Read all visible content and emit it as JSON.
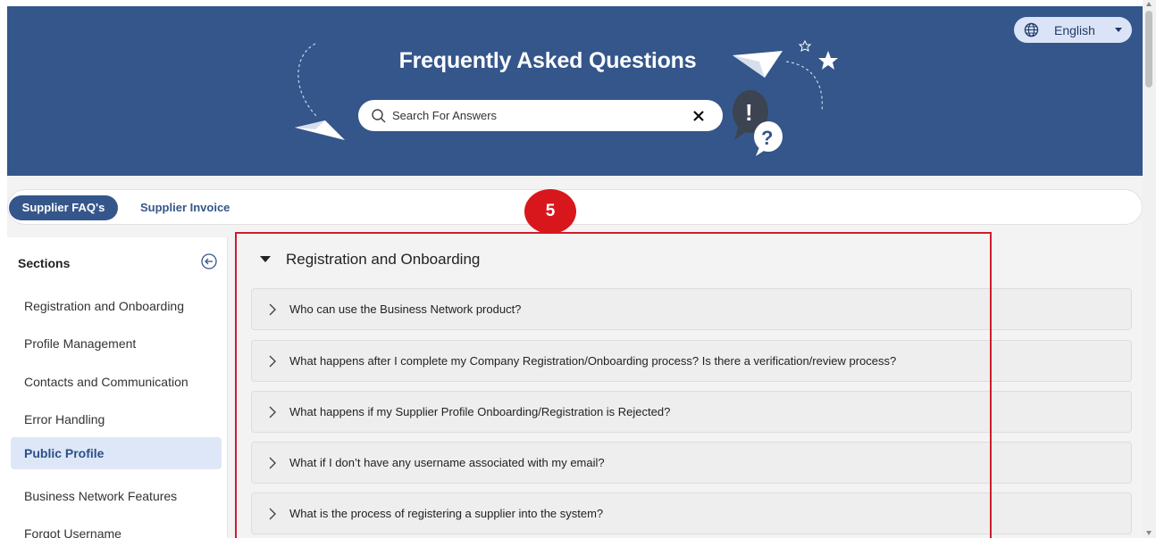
{
  "header": {
    "title": "Frequently Asked Questions",
    "language": "English",
    "icons": [
      "globe-icon",
      "paper-plane-icon",
      "speech-bubbles-icon",
      "star-icon"
    ]
  },
  "search": {
    "placeholder": "Search For Answers",
    "value": "Search For Answers"
  },
  "tabs": [
    {
      "label": "Supplier FAQ's",
      "active": true
    },
    {
      "label": "Supplier Invoice",
      "active": false
    }
  ],
  "sidebar": {
    "heading": "Sections",
    "items": [
      {
        "label": "Registration and Onboarding"
      },
      {
        "label": "Profile Management"
      },
      {
        "label": "Contacts and Communication"
      },
      {
        "label": "Error Handling"
      },
      {
        "label": "Public Profile",
        "active": true
      },
      {
        "label": "Business Network Features"
      },
      {
        "label": "Forgot Username"
      }
    ]
  },
  "content": {
    "section_title": "Registration and Onboarding",
    "questions": [
      "Who can use the Business Network product?",
      "What happens after I complete my Company Registration/Onboarding process? Is there a verification/review process?",
      "What happens if my Supplier Profile Onboarding/Registration is Rejected?",
      "What if I don’t have any username associated with my email?",
      "What is the process of registering a supplier into the system?"
    ]
  },
  "annotation": {
    "badge": "5"
  },
  "colors": {
    "header_bg": "#34568b",
    "active_tab": "#34568b",
    "sidebar_active_bg": "#dde7f8",
    "annotation": "#d8171c"
  }
}
